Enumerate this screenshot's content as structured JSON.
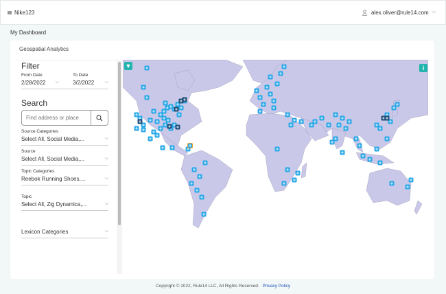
{
  "header": {
    "brand": "Nike123",
    "user_email": "alex.oliver@rule14.com",
    "menu_icon": "menu-icon",
    "user_icon": "user-icon"
  },
  "breadcrumb": "My Dashboard",
  "card": {
    "title": "Geospatial Analytics"
  },
  "filter": {
    "heading": "Filter",
    "from_label": "From Date",
    "from_value": "2/28/2022",
    "to_label": "To Date",
    "to_value": "3/2/2022",
    "search_heading": "Search",
    "search_placeholder": "Find address or place",
    "selects": [
      {
        "label": "Source Categories",
        "value": "Select All, Social Media,..."
      },
      {
        "label": "Source",
        "value": "Select All, Social Media,..."
      },
      {
        "label": "Topic Categories",
        "value": "Reebok Running Shoes,..."
      },
      {
        "label": "Topic",
        "value": "Select All, Zig Dynamica,..."
      },
      {
        "label": "",
        "value": "Lexicon Categories"
      }
    ]
  },
  "map": {
    "land_color": "#cac8e8",
    "marker_color": "#29a8e8",
    "marker_dark_color": "#1f4f7a",
    "marker_icon": "twitter-icon",
    "filter_icon": "filter-icon",
    "info_icon": "info-icon",
    "accent": "#22b5ad"
  },
  "footer": {
    "copyright": "Copyright © 2022, Rule14 LLC, All Rights Reserved.",
    "privacy": "Privacy Policy"
  }
}
